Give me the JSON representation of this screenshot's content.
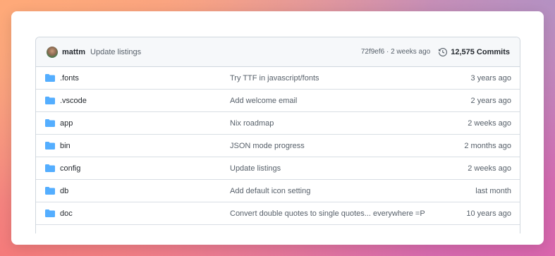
{
  "header": {
    "author": "mattm",
    "commit_message": "Update listings",
    "sha_and_time": "72f9ef6 · 2 weeks ago",
    "commits_count": "12,575 Commits"
  },
  "files": [
    {
      "name": ".fonts",
      "message": "Try TTF in javascript/fonts",
      "time": "3 years ago",
      "icon": "folder-icon"
    },
    {
      "name": ".vscode",
      "message": "Add welcome email",
      "time": "2 years ago",
      "icon": "folder-icon"
    },
    {
      "name": "app",
      "message": "Nix roadmap",
      "time": "2 weeks ago",
      "icon": "folder-icon"
    },
    {
      "name": "bin",
      "message": "JSON mode progress",
      "time": "2 months ago",
      "icon": "folder-icon"
    },
    {
      "name": "config",
      "message": "Update listings",
      "time": "2 weeks ago",
      "icon": "folder-icon"
    },
    {
      "name": "db",
      "message": "Add default icon setting",
      "time": "last month",
      "icon": "folder-icon"
    },
    {
      "name": "doc",
      "message": "Convert double quotes to single quotes... everywhere =P",
      "time": "10 years ago",
      "icon": "folder-icon"
    }
  ],
  "colors": {
    "folder": "#54aeff",
    "header_bg": "#f6f8fa",
    "border": "#d0d7de"
  }
}
